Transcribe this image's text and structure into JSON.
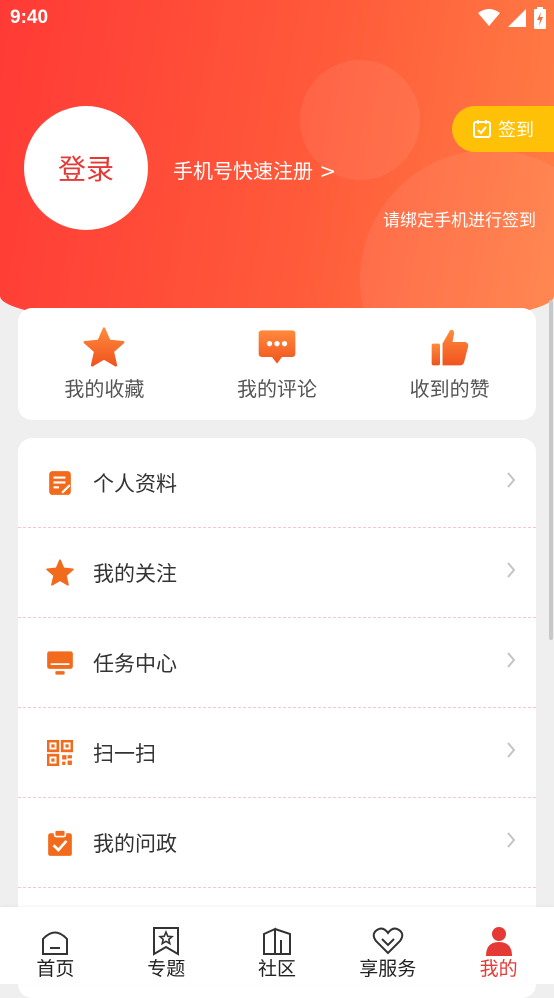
{
  "status_bar": {
    "time": "9:40"
  },
  "header": {
    "login_label": "登录",
    "register_label": "手机号快速注册 >",
    "checkin_label": "签到",
    "bind_tip": "请绑定手机进行签到"
  },
  "quick_actions": [
    {
      "label": "我的收藏",
      "icon": "star-icon"
    },
    {
      "label": "我的评论",
      "icon": "comment-icon"
    },
    {
      "label": "收到的赞",
      "icon": "thumbs-up-icon"
    }
  ],
  "menu": [
    {
      "label": "个人资料",
      "icon": "profile-doc-icon"
    },
    {
      "label": "我的关注",
      "icon": "star-icon"
    },
    {
      "label": "任务中心",
      "icon": "monitor-icon"
    },
    {
      "label": "扫一扫",
      "icon": "qr-code-icon"
    },
    {
      "label": "我的问政",
      "icon": "clipboard-check-icon"
    }
  ],
  "tabs": [
    {
      "label": "首页",
      "icon": "home-icon",
      "active": false
    },
    {
      "label": "专题",
      "icon": "bookmark-star-icon",
      "active": false
    },
    {
      "label": "社区",
      "icon": "community-icon",
      "active": false
    },
    {
      "label": "享服务",
      "icon": "heart-icon",
      "active": false
    },
    {
      "label": "我的",
      "icon": "person-icon",
      "active": true
    }
  ],
  "colors": {
    "accent_red": "#e53935",
    "header_start": "#ff3a36",
    "header_end": "#ff7f45",
    "icon_orange": "#f26a1b",
    "checkin_yellow": "#ffc107"
  }
}
